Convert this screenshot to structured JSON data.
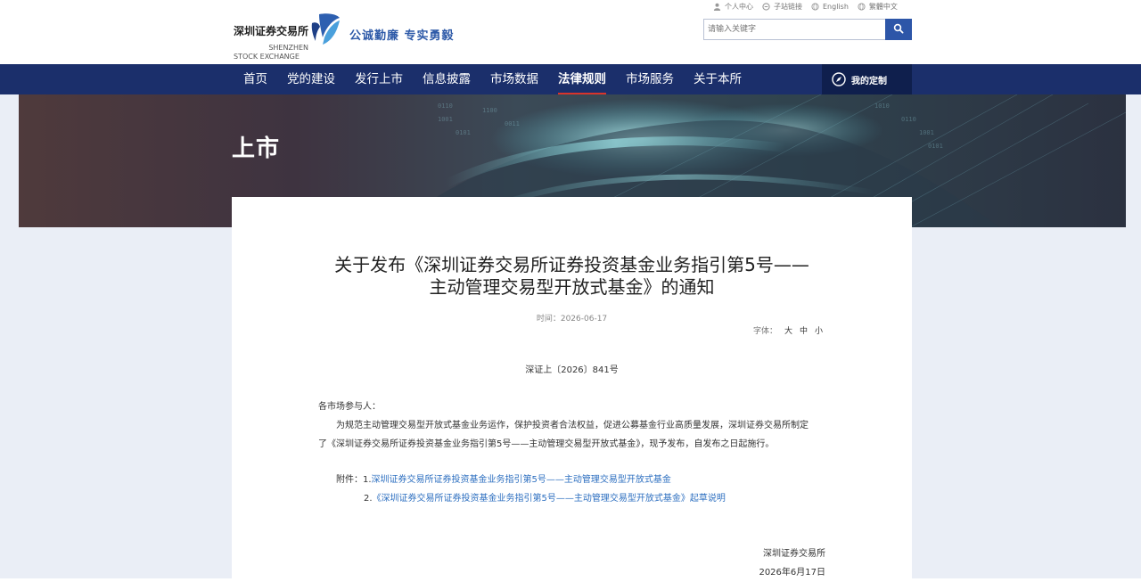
{
  "header": {
    "logo_cn": "深圳证券交易所",
    "logo_en_line1": "SHENZHEN",
    "logo_en_line2": "STOCK EXCHANGE",
    "slogan": "公诚勤廉 专实勇毅",
    "toplinks": [
      "个人中心",
      "子站链接",
      "English",
      "繁體中文"
    ],
    "search_placeholder": "请输入关键字"
  },
  "nav": {
    "items": [
      "首页",
      "党的建设",
      "发行上市",
      "信息披露",
      "市场数据",
      "法律规则",
      "市场服务",
      "关于本所"
    ],
    "active": "法律规则",
    "custom": "我的定制"
  },
  "banner": {
    "title": "上市"
  },
  "colors": {
    "nav": "#1b2f6b",
    "accent_red": "#d9342b",
    "link": "#2d6fc0",
    "search_btn": "#2d56a8"
  },
  "article": {
    "title_line1": "关于发布《深圳证券交易所证券投资基金业务指引第5号——",
    "title_line2": "主动管理交易型开放式基金》的通知",
    "time": "时间：2026-06-17",
    "font_label": "字体：",
    "font_sizes": [
      "大",
      "中",
      "小"
    ],
    "doc_no": "深证上〔2026〕841号",
    "salutation": "各市场参与人：",
    "para1": "为规范主动管理交易型开放式基金业务运作，保护投资者合法权益，促进公募基金行业高质量发展，深圳证券交易所制定",
    "para2": "了《深圳证券交易所证券投资基金业务指引第5号——主动管理交易型开放式基金》，现予发布，自发布之日起施行。",
    "attach_label": "附件：",
    "attach1_no": "1.",
    "attach1": "深圳证券交易所证券投资基金业务指引第5号——主动管理交易型开放式基金",
    "attach2_no": "2.",
    "attach2": "《深圳证券交易所证券投资基金业务指引第5号——主动管理交易型开放式基金》起草说明",
    "signature": "深圳证券交易所",
    "date": "2026年6月17日"
  }
}
